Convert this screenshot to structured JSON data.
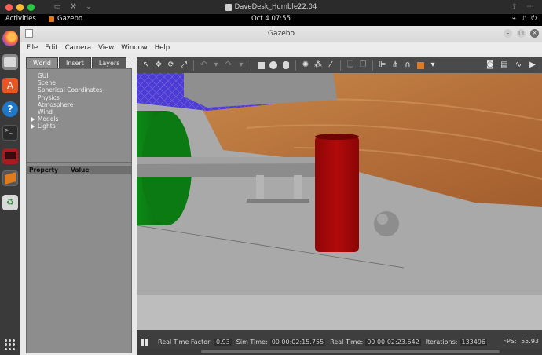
{
  "host": {
    "window_title": "DaveDesk_Humble22.04",
    "traffic_colors": [
      "#ff5f57",
      "#febc2e",
      "#28c840"
    ]
  },
  "ubuntu_bar": {
    "activities": "Activities",
    "app_name": "Gazebo",
    "clock": "Oct 4  07:55"
  },
  "dock": {
    "items": [
      "firefox-icon",
      "files-icon",
      "app-center-icon",
      "help-icon",
      "terminal-icon",
      "monitor-icon",
      "gazebo-icon",
      "trash-icon"
    ]
  },
  "gazebo": {
    "title": "Gazebo",
    "menu": [
      "File",
      "Edit",
      "Camera",
      "View",
      "Window",
      "Help"
    ],
    "tabs": [
      "World",
      "Insert",
      "Layers"
    ],
    "selected_tab": "World",
    "tree": [
      "GUI",
      "Scene",
      "Spherical Coordinates",
      "Physics",
      "Atmosphere",
      "Wind",
      "Models",
      "Lights"
    ],
    "tree_expandable": [
      "Models",
      "Lights"
    ],
    "props": {
      "property": "Property",
      "value": "Value"
    },
    "status": {
      "rtf_label": "Real Time Factor:",
      "rtf": "0.93",
      "sim_label": "Sim Time:",
      "sim": "00 00:02:15.755",
      "real_label": "Real Time:",
      "real": "00 00:02:23.642",
      "iter_label": "Iterations:",
      "iter": "133496",
      "fps_label": "FPS:",
      "fps": "55.93"
    }
  }
}
